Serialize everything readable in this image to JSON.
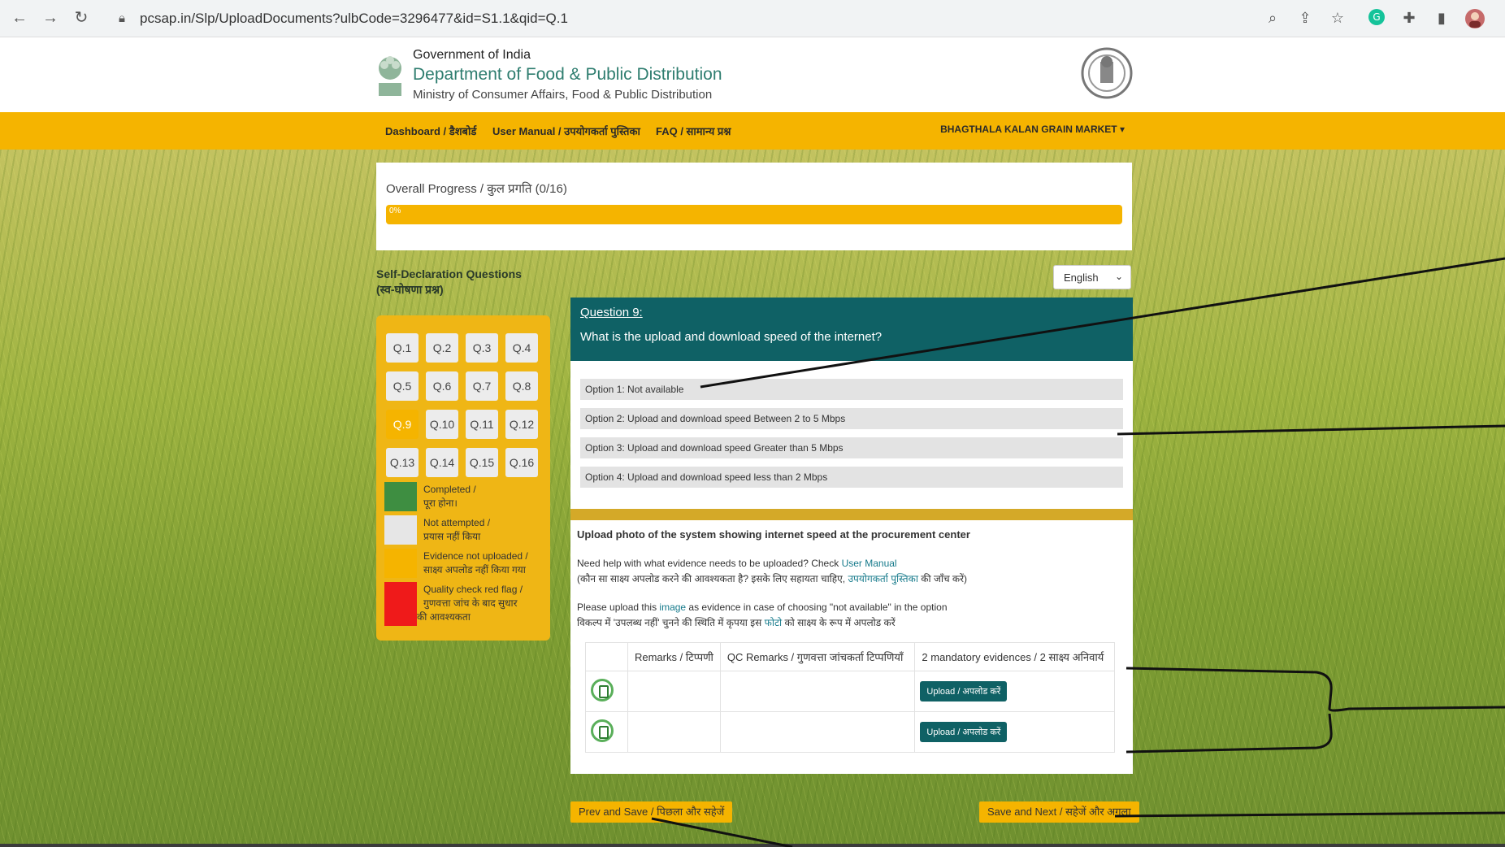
{
  "browser": {
    "url": "pcsap.in/Slp/UploadDocuments?ulbCode=3296477&id=S1.1&qid=Q.1"
  },
  "header": {
    "gov": "Government of India",
    "dept": "Department of Food & Public Distribution",
    "ministry": "Ministry of Consumer Affairs, Food & Public Distribution"
  },
  "nav": {
    "items": [
      "Dashboard / डैशबोर्ड",
      "User Manual / उपयोगकर्ता पुस्तिका",
      "FAQ / सामान्य प्रश्न"
    ],
    "market": "BHAGTHALA KALAN GRAIN MARKET"
  },
  "progress": {
    "label": "Overall Progress / कुल प्रगति (0/16)",
    "percent_text": "0%",
    "value": 0
  },
  "sidebar": {
    "title_en": "Self-Declaration Questions",
    "title_hi": "(स्व-घोषणा प्रश्न)",
    "questions": [
      "Q.1",
      "Q.2",
      "Q.3",
      "Q.4",
      "Q.5",
      "Q.6",
      "Q.7",
      "Q.8",
      "Q.9",
      "Q.10",
      "Q.11",
      "Q.12",
      "Q.13",
      "Q.14",
      "Q.15",
      "Q.16"
    ],
    "active": "Q.9",
    "legend": [
      {
        "line1": "Completed /",
        "line2": "पूरा होना।",
        "color": "#3e8e41"
      },
      {
        "line1": "Not attempted /",
        "line2": "प्रयास नहीं किया",
        "color": "#e6e6e6"
      },
      {
        "line1": "Evidence not uploaded /",
        "line2": "साक्ष्य अपलोड नहीं किया गया",
        "color": "#f5b400"
      },
      {
        "line1": "Quality check red flag /",
        "line2": "गुणवत्ता जांच के बाद सुधार",
        "line3": "की आवश्यकता",
        "color": "#ef1a1a"
      }
    ]
  },
  "language": {
    "selected": "English"
  },
  "question": {
    "number": "Question 9:",
    "text": "What is the upload and download speed of the internet?",
    "options": [
      "Option 1: Not available",
      "Option 2: Upload and download speed Between 2 to 5 Mbps",
      "Option 3: Upload and download speed Greater than 5 Mbps",
      "Option 4: Upload and download speed less than 2 Mbps"
    ]
  },
  "evidence": {
    "title": "Upload photo of the system showing internet speed at the procurement center",
    "help_en_prefix": "Need help with what evidence needs to be uploaded? Check ",
    "help_en_link": "User Manual",
    "help_hi_prefix": "(कौन सा साक्ष्य अपलोड करने की आवश्यकता है? इसके लिए सहायता चाहिए, ",
    "help_hi_link": "उपयोगकर्ता पुस्तिका",
    "help_hi_suffix": " की जाँच करें)",
    "upload_en_prefix": "Please upload this ",
    "upload_en_link": "image",
    "upload_en_suffix": " as evidence in case of choosing \"not available\" in the option",
    "upload_hi_prefix": "विकल्प में 'उपलब्ध नहीं' चुनने की स्थिति में कृपया इस ",
    "upload_hi_link": "फोटो",
    "upload_hi_suffix": " को साक्ष्य के रूप में अपलोड करें",
    "table": {
      "headers": [
        "",
        "Remarks / टिप्पणी",
        "QC Remarks / गुणवत्ता जांचकर्ता टिप्पणियाँ",
        "2 mandatory evidences / 2 साक्ष्य अनिवार्य"
      ],
      "upload_label": "Upload / अपलोड करें"
    }
  },
  "footer": {
    "prev": "Prev and Save / पिछला और सहेजें",
    "next": "Save and Next / सहेजें और अगला"
  },
  "colors": {
    "brand_yellow": "#f5b400",
    "teal": "#0f6165",
    "dept_green": "#2e7d6f"
  }
}
